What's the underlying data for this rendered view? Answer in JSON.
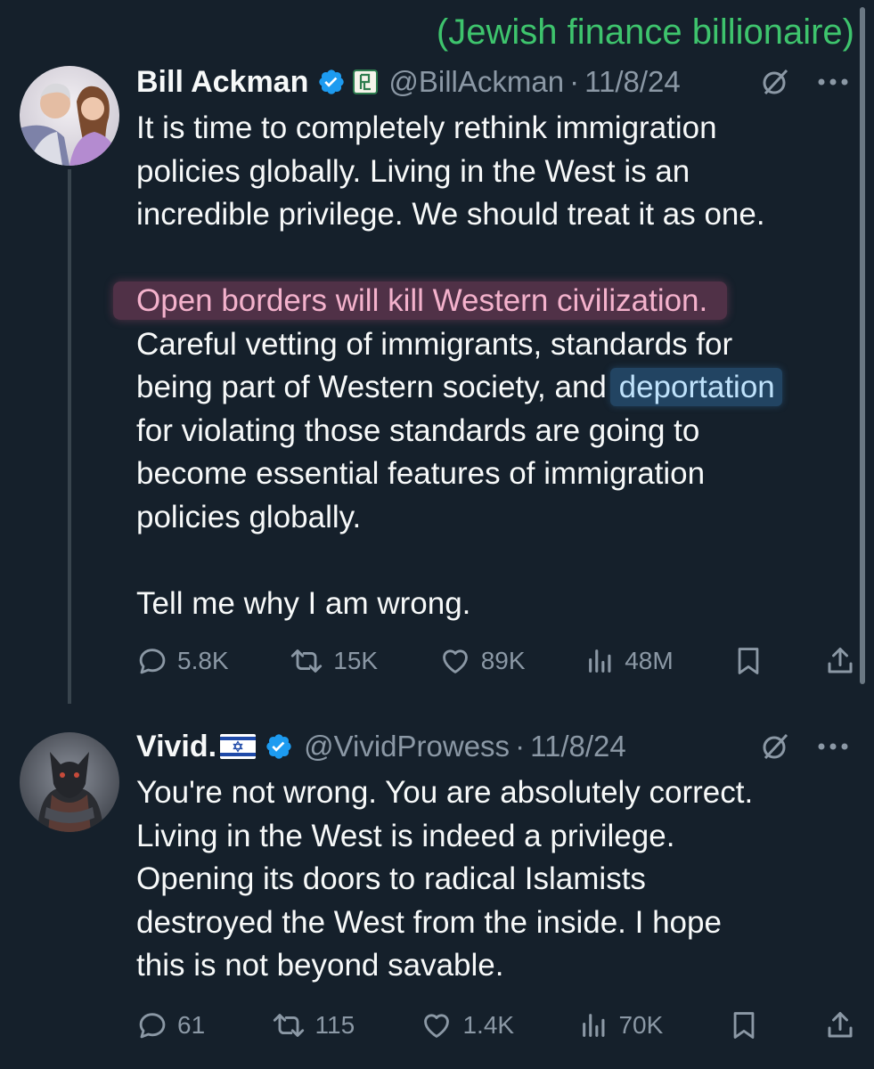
{
  "annotation": "(Jewish finance billionaire)",
  "tweets": [
    {
      "name": "Bill Ackman",
      "handle": "@BillAckman",
      "separator": "·",
      "date": "11/8/24",
      "lines_para1": [
        "It is time to completely rethink immigration",
        "policies globally. Living in the West is an",
        "incredible privilege. We should treat it as one."
      ],
      "highlight_line": "Open borders will kill Western civilization.",
      "line_pre_deport": "being part of Western society, and ",
      "highlight_word": "deportation",
      "lines_para2_a": "Careful vetting of immigrants, standards for",
      "lines_para2_rest": [
        "for violating those standards are going to",
        "become essential features of immigration",
        "policies globally."
      ],
      "closing": "Tell me why I am wrong.",
      "stats": {
        "replies": "5.8K",
        "reposts": "15K",
        "likes": "89K",
        "views": "48M"
      }
    },
    {
      "name": "Vivid.",
      "flag": "israel-flag",
      "handle": "@VividProwess",
      "separator": "·",
      "date": "11/8/24",
      "lines": [
        "You're not wrong. You are absolutely correct.",
        "Living in the West is indeed a privilege.",
        "Opening its doors to radical Islamists",
        "destroyed the West from the inside. I hope",
        "this is not beyond savable."
      ],
      "stats": {
        "replies": "61",
        "reposts": "115",
        "likes": "1.4K",
        "views": "70K"
      }
    }
  ],
  "colors": {
    "background": "#15202b",
    "text": "#f7f9f9",
    "muted": "#8b98a5",
    "verified": "#1d9bf0",
    "annotation": "#3ec46d"
  }
}
